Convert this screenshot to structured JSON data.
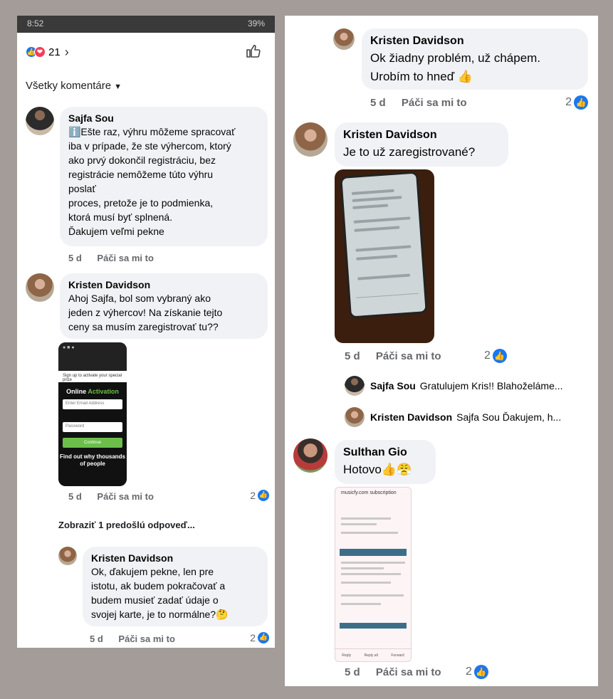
{
  "left_panel": {
    "status_bar": {
      "time": "8:52",
      "battery": "39%"
    },
    "reactions": {
      "count": "21",
      "icons": [
        "like-icon",
        "love-icon"
      ]
    },
    "filter": {
      "label": "Všetky komentáre"
    },
    "comments": [
      {
        "author": "Sajfa Sou",
        "text": "ℹ️Ešte raz, výhru môžeme spracovať\niba v prípade, že ste výhercom, ktorý\nako prvý dokončil registráciu, bez\nregistrácie nemôžeme túto výhru\nposlať\nproces, pretože je to podmienka,\nktorá musí byť splnená.\nĎakujem veľmi pekne",
        "time": "5 d",
        "like_label": "Páči sa mi to"
      },
      {
        "author": "Kristen Davidson",
        "text": "Ahoj Sajfa, bol som vybraný ako\njeden z výhercov! Na získanie tejto\nceny sa musím zaregistrovať tu??",
        "time": "5 d",
        "like_label": "Páči sa mi to",
        "like_count": "2",
        "attachment": {
          "title_a": "Online",
          "title_b": "Activation",
          "warning": "Sign up to activate your special prize",
          "field1": "Enter Email Address",
          "field2": "Password",
          "button": "Continue",
          "footer": "Find out why thousands of people"
        }
      }
    ],
    "previous_replies": "Zobraziť 1 predošlú odpoveď...",
    "reply": {
      "author": "Kristen Davidson",
      "text": "Ok, ďakujem pekne, len pre\nistotu, ak budem pokračovať a\nbudem musieť zadať údaje o\nsvojej karte, je to normálne?🤔",
      "time": "5 d",
      "like_label": "Páči sa mi to",
      "like_count": "2"
    }
  },
  "right_panel": {
    "comments": [
      {
        "author": "Kristen Davidson",
        "text": "Ok žiadny problém, už chápem.\nUrobím to hneď 👍",
        "time": "5 d",
        "like_label": "Páči sa mi to",
        "like_count": "2"
      },
      {
        "author": "Kristen Davidson",
        "text": "Je to už zaregistrované?",
        "time": "5 d",
        "like_label": "Páči sa mi to",
        "like_count": "2"
      }
    ],
    "replies": [
      {
        "author": "Sajfa Sou",
        "text": "Gratulujem Kris!! Blahoželáme..."
      },
      {
        "author": "Kristen Davidson",
        "text": "Sajfa Sou Ďakujem, h..."
      }
    ],
    "last_comment": {
      "author": "Sulthan Gio",
      "text": "Hotovo👍😤",
      "time": "5 d",
      "like_label": "Páči sa mi to",
      "like_count": "2",
      "attachment": {
        "title": "musicfy.com subscription",
        "nav": [
          "Reply",
          "Reply all",
          "Forward"
        ]
      }
    }
  },
  "colors": {
    "accent": "#1877f2",
    "love": "#f33e58",
    "bubble": "#f0f2f5",
    "background": "#a39c99"
  }
}
